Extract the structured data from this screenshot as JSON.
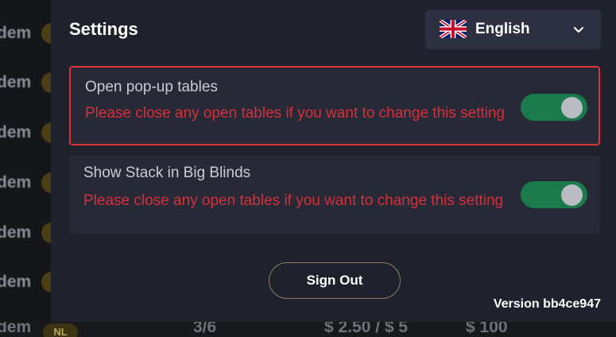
{
  "background": {
    "row_fragment": "dem",
    "bottom_row": {
      "badge": "NL",
      "stakes": "3/6",
      "blinds": "$ 2.50 / $ 5",
      "buyin": "$ 100"
    }
  },
  "settings": {
    "title": "Settings",
    "language": {
      "selected": "English",
      "flag_icon": "uk-flag-icon"
    },
    "options": [
      {
        "label": "Open pop-up tables",
        "warning": "Please close any open tables if you want to change this setting",
        "enabled": true,
        "highlighted": true
      },
      {
        "label": "Show Stack in Big Blinds",
        "warning": "Please close any open tables if you want to change this setting",
        "enabled": true,
        "highlighted": false
      }
    ],
    "sign_out_label": "Sign Out",
    "version": "Version bb4ce947"
  },
  "colors": {
    "toggle_on": "#1a7a4c",
    "warning": "#d3313b",
    "highlight_border": "#e1303a",
    "panel": "#1f222d"
  }
}
